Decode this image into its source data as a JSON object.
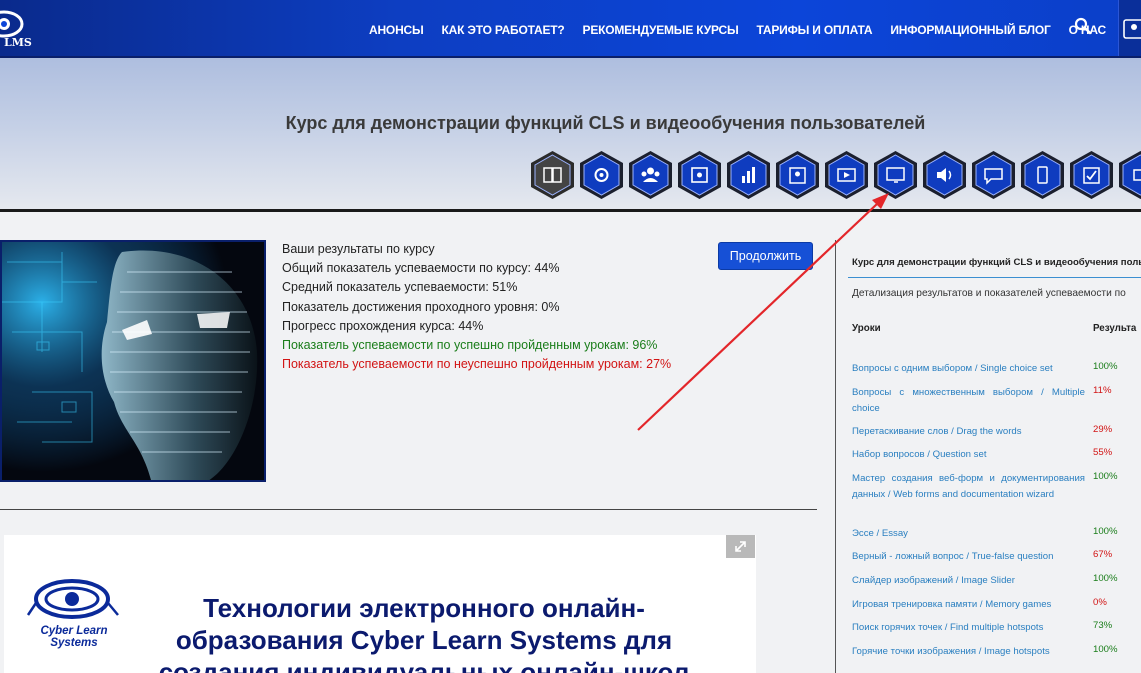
{
  "header": {
    "logo_text": "LMS",
    "nav": [
      "АНОНСЫ",
      "КАК ЭТО РАБОТАЕТ?",
      "РЕКОМЕНДУЕМЫЕ КУРСЫ",
      "ТАРИФЫ И ОПЛАТА",
      "ИНФОРМАЦИОННЫЙ БЛОГ",
      "О НАС"
    ],
    "search_icon": "search-icon",
    "user_icon": "user-icon"
  },
  "banner": {
    "title": "Курс для демонстрации функций CLS и видеообучения пользователей",
    "icons": [
      "book-icon",
      "gear-icon",
      "group-icon",
      "puzzle-icon",
      "bar-chart-icon",
      "user-card-icon",
      "video-icon",
      "screen-icon",
      "speaker-icon",
      "chat-icon",
      "mobile-icon",
      "checklist-icon",
      "more-icon"
    ]
  },
  "results": {
    "heading": "Ваши результаты по курсу",
    "overall": "Общий показатель успеваемости по курсу: 44%",
    "average": "Средний показатель успеваемости: 51%",
    "pass_level": "Показатель достижения проходного уровня: 0%",
    "progress": "Прогресс прохождения курса: 44%",
    "passed": "Показатель успеваемости по успешно пройденным урокам: 96%",
    "failed": "Показатель успеваемости по неуспешно пройденным урокам: 27%",
    "continue_label": "Продолжить"
  },
  "slide": {
    "logo_text_1": "Cyber Learn",
    "logo_text_2": "Systems",
    "title_1": "Технологии электронного онлайн-",
    "title_2": "образования   Cyber Learn Systems для",
    "title_3": "создания индивидуальных онлайн-школ"
  },
  "sidebar": {
    "title": "Курс для демонстрации функций CLS и видеообучения поль",
    "subtitle": "Детализация результатов и показателей успеваемости по",
    "col_lessons": "Уроки",
    "col_results": "Результа",
    "rows": [
      {
        "lesson": "Вопросы с одним выбором / Single choice set",
        "pct": "100%",
        "ok": true
      },
      {
        "lesson": "Вопросы с множественным выбором / Multiple choice",
        "pct": "11%",
        "ok": false
      },
      {
        "lesson": "Перетаскивание слов / Drag the words",
        "pct": "29%",
        "ok": false
      },
      {
        "lesson": "Набор вопросов / Question set",
        "pct": "55%",
        "ok": false
      },
      {
        "lesson": "Мастер создания веб-форм и документирования данных / Web forms and documentation wizard",
        "pct": "100%",
        "ok": true
      },
      {
        "lesson": "Эссе / Essay",
        "pct": "100%",
        "ok": true
      },
      {
        "lesson": "Верный - ложный вопрос / True-false question",
        "pct": "67%",
        "ok": false
      },
      {
        "lesson": "Слайдер изображений / Image Slider",
        "pct": "100%",
        "ok": true
      },
      {
        "lesson": "Игровая тренировка памяти / Memory games",
        "pct": "0%",
        "ok": false
      },
      {
        "lesson": "Поиск горячих точек / Find multiple hotspots",
        "pct": "73%",
        "ok": true
      },
      {
        "lesson": "Горячие точки изображения / Image hotspots",
        "pct": "100%",
        "ok": true
      }
    ]
  },
  "colors": {
    "header_blue": "#0c45d9",
    "button_blue": "#1650d6",
    "link_blue": "#2a7fc0",
    "success_green": "#1a7d1a",
    "fail_red": "#d21414",
    "annotation_arrow": "#e3262a"
  }
}
